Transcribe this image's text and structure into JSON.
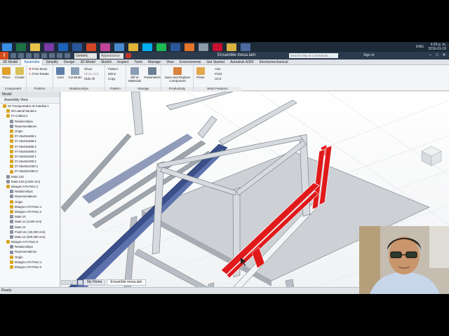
{
  "taskbar": {
    "clock_time": "4:29 p. m.",
    "clock_date": "2016-01-19",
    "language": "ENG",
    "app_icons": [
      {
        "name": "windows-start-icon",
        "color": "#3a8ee6"
      },
      {
        "name": "excel-icon",
        "color": "#1f7244"
      },
      {
        "name": "file-explorer-icon",
        "color": "#e8c34a"
      },
      {
        "name": "onenote-icon",
        "color": "#7b3aa8"
      },
      {
        "name": "outlook-icon",
        "color": "#1c62b9"
      },
      {
        "name": "word-icon",
        "color": "#2b579a"
      },
      {
        "name": "powerpoint-icon",
        "color": "#d24726"
      },
      {
        "name": "paint-icon",
        "color": "#c0449a"
      },
      {
        "name": "app-icon",
        "color": "#4a8bd0"
      },
      {
        "name": "chrome-icon",
        "color": "#e0b53a"
      },
      {
        "name": "skype-icon",
        "color": "#00aff0"
      },
      {
        "name": "spotify-icon",
        "color": "#1db954"
      },
      {
        "name": "word-icon",
        "color": "#2b579a"
      },
      {
        "name": "inventor-icon",
        "color": "#e6732a"
      },
      {
        "name": "notes-icon",
        "color": "#8a9aa8"
      },
      {
        "name": "acrobat-icon",
        "color": "#c8102e"
      },
      {
        "name": "folder-icon",
        "color": "#d8b341"
      },
      {
        "name": "app-icon",
        "color": "#4d6aa0"
      }
    ]
  },
  "titlebar": {
    "document_title": "Ensamble mesa.iam",
    "material_dropdown": "Generic",
    "appearance_dropdown": "Appearance",
    "help_search_placeholder": "Search Help & Commands...",
    "sign_in": "Sign In"
  },
  "ribbon_tabs": [
    {
      "label": "3D Model"
    },
    {
      "label": "Assemble",
      "active": true
    },
    {
      "label": "Simplify"
    },
    {
      "label": "Design"
    },
    {
      "label": "3D Model"
    },
    {
      "label": "Sketch"
    },
    {
      "label": "Inspect"
    },
    {
      "label": "Tools"
    },
    {
      "label": "Manage"
    },
    {
      "label": "View"
    },
    {
      "label": "Environments"
    },
    {
      "label": "Get Started"
    },
    {
      "label": "Autodesk A360"
    },
    {
      "label": "Electromechanical"
    }
  ],
  "ribbon": {
    "component_group": {
      "label": "Component",
      "place": "Place",
      "create": "Create"
    },
    "position_group": {
      "label": "Position",
      "free_move": "Free Move",
      "free_rotate": "Free Rotate"
    },
    "relationships_group": {
      "label": "Relationships",
      "joint": "Joint",
      "constrain": "Constrain",
      "show": "Show",
      "show_sick": "Show Sick",
      "hide_all": "Hide All"
    },
    "pattern_group": {
      "label": "Pattern",
      "pattern": "Pattern",
      "mirror": "Mirror",
      "copy": "Copy"
    },
    "manage_group": {
      "label": "Manage",
      "bill_of_materials": "Bill of Materials",
      "parameters": "Parameters"
    },
    "productivity_group": {
      "label": "Productivity",
      "save_replace": "Save and Replace Component"
    },
    "work_features_group": {
      "label": "Work Features",
      "plane": "Plane",
      "axis": "Axis",
      "point": "Point",
      "ucs": "UCS"
    }
  },
  "browser": {
    "header": "Model",
    "view": "Assembly View",
    "tree": [
      {
        "indent": 0,
        "label": "04-Transportador de botellas:1",
        "icon": "#d9a520"
      },
      {
        "indent": 1,
        "label": "06-Lateral banda:1",
        "icon": "#d9a520"
      },
      {
        "indent": 1,
        "label": "07-Cabina:1",
        "icon": "#d9a520"
      },
      {
        "indent": 2,
        "label": "Relationships",
        "icon": "#8a8fa0"
      },
      {
        "indent": 2,
        "label": "Representations",
        "icon": "#8a8fa0"
      },
      {
        "indent": 2,
        "label": "Origin",
        "icon": "#d9a520"
      },
      {
        "indent": 2,
        "label": "07-45x45x695:1",
        "icon": "#d9a520"
      },
      {
        "indent": 2,
        "label": "07-45x45x695:2",
        "icon": "#d9a520"
      },
      {
        "indent": 2,
        "label": "07-45x45x695:3",
        "icon": "#d9a520"
      },
      {
        "indent": 2,
        "label": "07-45x45x695:4",
        "icon": "#d9a520"
      },
      {
        "indent": 2,
        "label": "07-45x45x300:1",
        "icon": "#d9a520"
      },
      {
        "indent": 2,
        "label": "07-45x45x300:2",
        "icon": "#d9a520"
      },
      {
        "indent": 2,
        "label": "07-45x45x1050:1",
        "icon": "#d9a520"
      },
      {
        "indent": 2,
        "label": "07-45x45x1050:2",
        "icon": "#d9a520"
      },
      {
        "indent": 1,
        "label": "Mate:132",
        "icon": "#8a8fa0"
      },
      {
        "indent": 1,
        "label": "Mate:133 (2,000 mm)",
        "icon": "#8a8fa0"
      },
      {
        "indent": 1,
        "label": "Bisagra-A70-Pasc:1",
        "icon": "#d9a520"
      },
      {
        "indent": 2,
        "label": "Relationships",
        "icon": "#8a8fa0"
      },
      {
        "indent": 2,
        "label": "Representations",
        "icon": "#8a8fa0"
      },
      {
        "indent": 2,
        "label": "Origin",
        "icon": "#d9a520"
      },
      {
        "indent": 2,
        "label": "Bisagra-A70-Pasc:1",
        "icon": "#d9a520"
      },
      {
        "indent": 2,
        "label": "Bisagra-A70-Pasc:2",
        "icon": "#d9a520"
      },
      {
        "indent": 2,
        "label": "Mate:10",
        "icon": "#8a8fa0"
      },
      {
        "indent": 2,
        "label": "Mate:11 (4,500 mm)",
        "icon": "#8a8fa0"
      },
      {
        "indent": 2,
        "label": "Mate:12",
        "icon": "#8a8fa0"
      },
      {
        "indent": 2,
        "label": "Flush:15 (-50,000 mm)",
        "icon": "#8a8fa0"
      },
      {
        "indent": 2,
        "label": "Mate:13 (300,000 mm)",
        "icon": "#8a8fa0"
      },
      {
        "indent": 1,
        "label": "Bisagra-A70-Pasc:2",
        "icon": "#d9a520"
      },
      {
        "indent": 2,
        "label": "Relationships",
        "icon": "#8a8fa0"
      },
      {
        "indent": 2,
        "label": "Representations",
        "icon": "#8a8fa0"
      },
      {
        "indent": 2,
        "label": "Origin",
        "icon": "#d9a520"
      },
      {
        "indent": 2,
        "label": "Bisagra-A70-Pasc:1",
        "icon": "#d9a520"
      },
      {
        "indent": 2,
        "label": "Bisagra-A70-Pasc:2",
        "icon": "#d9a520"
      }
    ]
  },
  "doc_tabs": [
    {
      "label": "My Home"
    },
    {
      "label": "Ensamble mesa.iam",
      "active": true
    }
  ],
  "status": {
    "text": "Ready"
  },
  "colors": {
    "accent": "#1d5ca8",
    "selection": "#e0191b",
    "frame": "#c9ced4",
    "conveyor": "#3b4f8a"
  }
}
